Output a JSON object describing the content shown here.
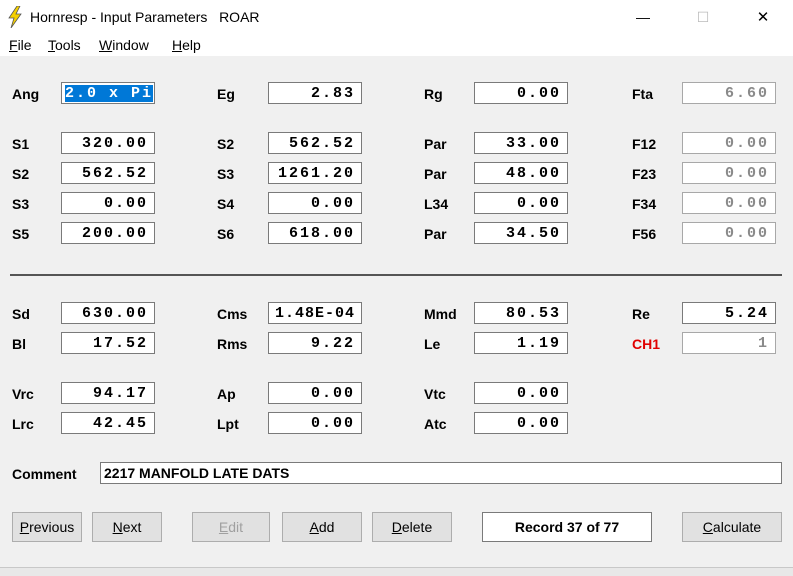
{
  "window": {
    "title": "Hornresp - Input Parameters   ROAR",
    "minimize": "—",
    "maximize": "☐",
    "close": "✕"
  },
  "menu": [
    {
      "acc": "F",
      "rest": "ile"
    },
    {
      "acc": "T",
      "rest": "ools"
    },
    {
      "acc": "W",
      "rest": "indow"
    },
    {
      "acc": "H",
      "rest": "elp"
    }
  ],
  "fields": {
    "ang_label": "Ang",
    "ang_value": "2.0 x Pi",
    "eg_label": "Eg",
    "eg_value": "2.83",
    "rg_label": "Rg",
    "rg_value": "0.00",
    "fta_label": "Fta",
    "fta_value": "6.60",
    "s1_label": "S1",
    "s1_value": "320.00",
    "s2a_label": "S2",
    "s2a_value": "562.52",
    "par1_label": "Par",
    "par1_value": "33.00",
    "f12_label": "F12",
    "f12_value": "0.00",
    "s2b_label": "S2",
    "s2b_value": "562.52",
    "s3a_label": "S3",
    "s3a_value": "1261.20",
    "par2_label": "Par",
    "par2_value": "48.00",
    "f23_label": "F23",
    "f23_value": "0.00",
    "s3b_label": "S3",
    "s3b_value": "0.00",
    "s4_label": "S4",
    "s4_value": "0.00",
    "l34_label": "L34",
    "l34_value": "0.00",
    "f34_label": "F34",
    "f34_value": "0.00",
    "s5_label": "S5",
    "s5_value": "200.00",
    "s6_label": "S6",
    "s6_value": "618.00",
    "par3_label": "Par",
    "par3_value": "34.50",
    "f56_label": "F56",
    "f56_value": "0.00",
    "sd_label": "Sd",
    "sd_value": "630.00",
    "cms_label": "Cms",
    "cms_value": "1.48E-04",
    "mmd_label": "Mmd",
    "mmd_value": "80.53",
    "re_label": "Re",
    "re_value": "5.24",
    "bl_label": "Bl",
    "bl_value": "17.52",
    "rms_label": "Rms",
    "rms_value": "9.22",
    "le_label": "Le",
    "le_value": "1.19",
    "ch1_label": "CH1",
    "ch1_value": "1",
    "vrc_label": "Vrc",
    "vrc_value": "94.17",
    "ap_label": "Ap",
    "ap_value": "0.00",
    "vtc_label": "Vtc",
    "vtc_value": "0.00",
    "lrc_label": "Lrc",
    "lrc_value": "42.45",
    "lpt_label": "Lpt",
    "lpt_value": "0.00",
    "atc_label": "Atc",
    "atc_value": "0.00"
  },
  "comment": {
    "label": "Comment",
    "value": "2217 MANFOLD LATE DATS"
  },
  "buttons": {
    "previous": {
      "acc": "P",
      "rest": "revious"
    },
    "next": {
      "acc": "N",
      "rest": "ext"
    },
    "edit": {
      "acc": "E",
      "rest": "dit"
    },
    "add": {
      "acc": "A",
      "rest": "dd"
    },
    "delete": {
      "acc": "D",
      "rest": "elete"
    },
    "calculate": {
      "acc": "C",
      "rest": "alculate"
    }
  },
  "record": "Record 37 of 77",
  "colors": {
    "highlight": "#0078d7",
    "warning_label": "#e00000"
  }
}
